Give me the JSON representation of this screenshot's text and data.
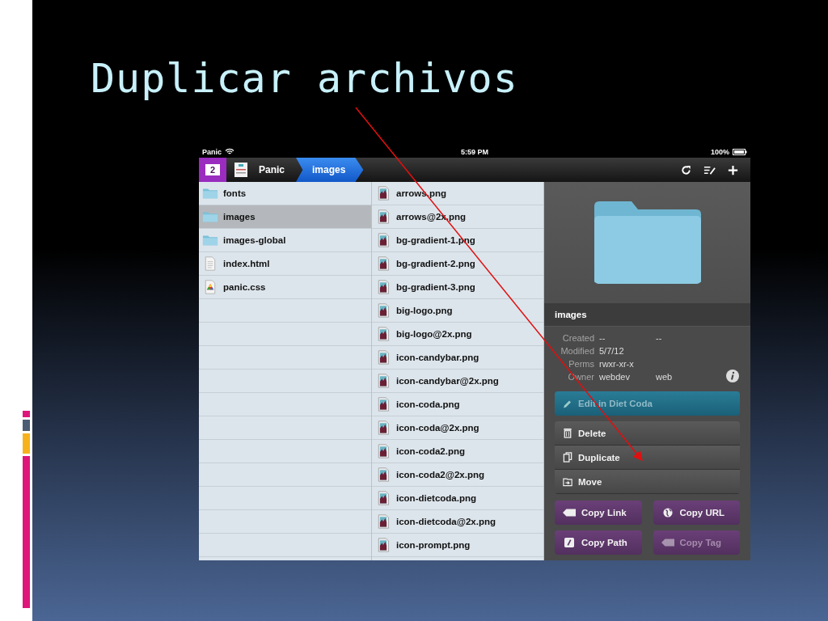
{
  "slide": {
    "title": "Duplicar archivos"
  },
  "status_bar": {
    "carrier": "Panic",
    "time": "5:59 PM",
    "battery": "100%"
  },
  "nav_bar": {
    "app_badge": "2",
    "breadcrumbs": [
      {
        "label": "Panic",
        "selected": false
      },
      {
        "label": "images",
        "selected": true
      }
    ]
  },
  "column_1": [
    {
      "name": "fonts",
      "kind": "folder",
      "selected": false
    },
    {
      "name": "images",
      "kind": "folder",
      "selected": true
    },
    {
      "name": "images-global",
      "kind": "folder",
      "selected": false
    },
    {
      "name": "index.html",
      "kind": "html",
      "selected": false
    },
    {
      "name": "panic.css",
      "kind": "css",
      "selected": false
    }
  ],
  "column_2": [
    "arrows.png",
    "arrows@2x.png",
    "bg-gradient-1.png",
    "bg-gradient-2.png",
    "bg-gradient-3.png",
    "big-logo.png",
    "big-logo@2x.png",
    "icon-candybar.png",
    "icon-candybar@2x.png",
    "icon-coda.png",
    "icon-coda@2x.png",
    "icon-coda2.png",
    "icon-coda2@2x.png",
    "icon-dietcoda.png",
    "icon-dietcoda@2x.png",
    "icon-prompt.png"
  ],
  "details": {
    "name": "images",
    "meta": [
      {
        "label": "Created",
        "value": "--",
        "extra": "--"
      },
      {
        "label": "Modified",
        "value": "5/7/12"
      },
      {
        "label": "Perms",
        "value": "rwxr-xr-x"
      },
      {
        "label": "Owner",
        "value": "webdev",
        "extra": "web"
      }
    ],
    "edit_button": "Edit in Diet Coda",
    "actions": [
      {
        "label": "Delete",
        "kind": "trash"
      },
      {
        "label": "Duplicate",
        "kind": "copy"
      },
      {
        "label": "Move",
        "kind": "move"
      }
    ],
    "copy_buttons": [
      {
        "label": "Copy Link",
        "kind": "link",
        "disabled": false
      },
      {
        "label": "Copy URL",
        "kind": "globe",
        "disabled": false
      },
      {
        "label": "Copy Path",
        "kind": "path",
        "disabled": false
      },
      {
        "label": "Copy Tag",
        "kind": "tag",
        "disabled": true
      }
    ]
  }
}
